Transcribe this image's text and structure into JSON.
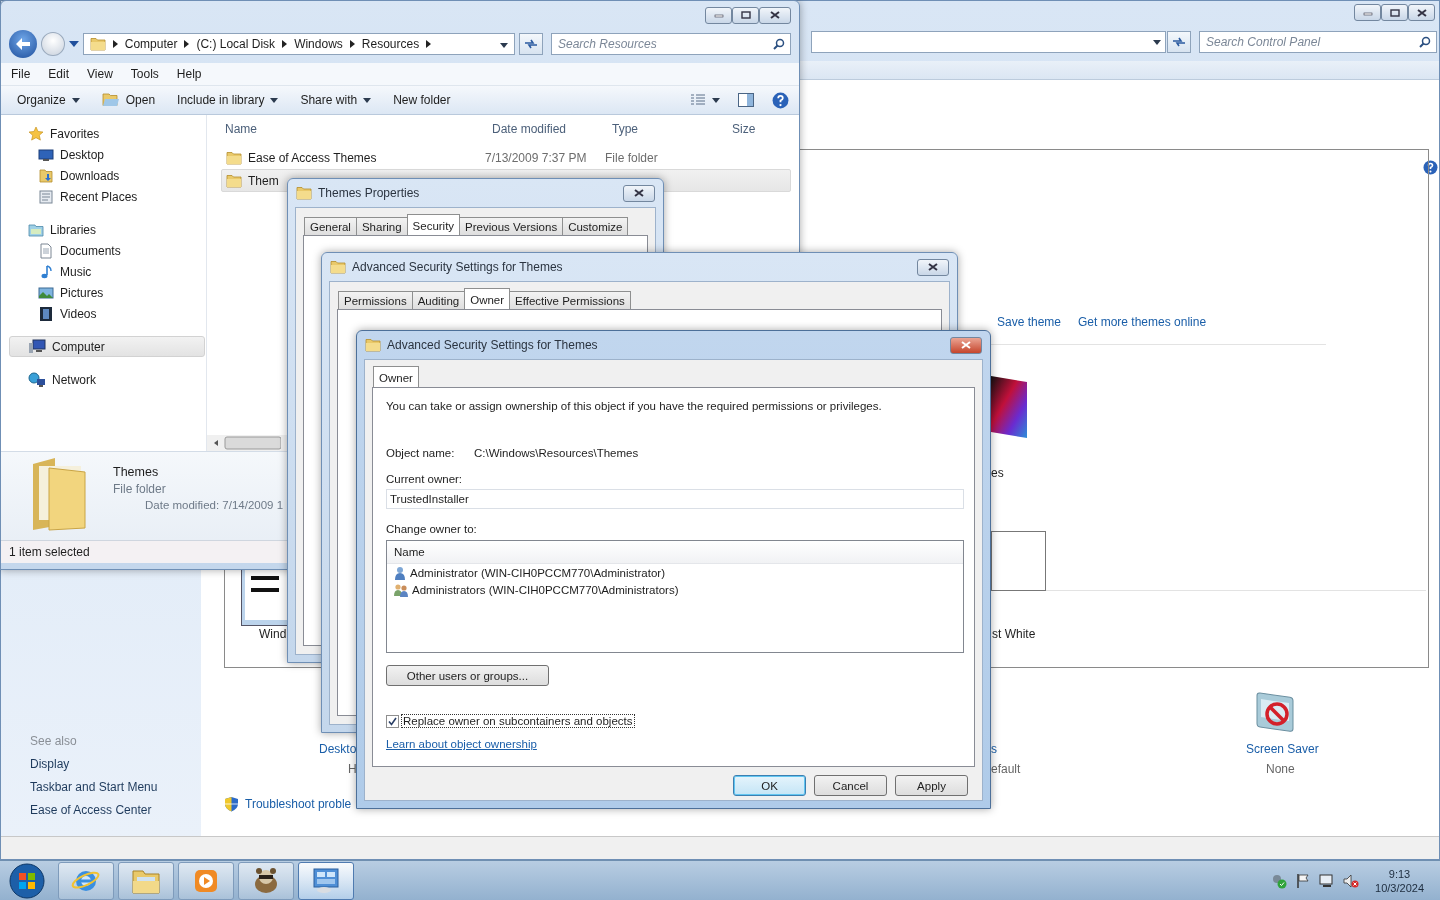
{
  "control_panel": {
    "search": {
      "placeholder": "Search Control Panel"
    },
    "theme_links": [
      "Save theme",
      "Get more themes online"
    ],
    "theme_labels": [
      "es",
      "st White",
      "Wind"
    ],
    "bottom_items": [
      {
        "label": "Deskto",
        "value": "H"
      },
      {
        "label": "s",
        "value": "efault"
      },
      {
        "label": "Screen Saver",
        "value": "None"
      }
    ],
    "see_also": {
      "heading": "See also",
      "links": [
        "Display",
        "Taskbar and Start Menu",
        "Ease of Access Center"
      ]
    },
    "troubleshoot_link": "Troubleshoot proble"
  },
  "explorer": {
    "breadcrumb": [
      "Computer",
      "(C:) Local Disk",
      "Windows",
      "Resources"
    ],
    "search": {
      "placeholder": "Search Resources"
    },
    "menu": [
      "File",
      "Edit",
      "View",
      "Tools",
      "Help"
    ],
    "toolbar": [
      {
        "label": "Organize",
        "kind": "menu"
      },
      {
        "label": "Open",
        "kind": "icon"
      },
      {
        "label": "Include in library",
        "kind": "menu"
      },
      {
        "label": "Share with",
        "kind": "menu"
      },
      {
        "label": "New folder",
        "kind": "plain"
      }
    ],
    "nav": [
      {
        "label": "Favorites",
        "kind": "star",
        "selected": false,
        "children": [
          {
            "label": "Desktop",
            "kind": "desktop",
            "selected": false
          },
          {
            "label": "Downloads",
            "kind": "downloads",
            "selected": false
          },
          {
            "label": "Recent Places",
            "kind": "recent",
            "selected": false
          }
        ]
      },
      {
        "label": "Libraries",
        "kind": "library",
        "selected": false,
        "children": [
          {
            "label": "Documents",
            "kind": "document",
            "selected": false
          },
          {
            "label": "Music",
            "kind": "music",
            "selected": false
          },
          {
            "label": "Pictures",
            "kind": "picture",
            "selected": false
          },
          {
            "label": "Videos",
            "kind": "video",
            "selected": false
          }
        ]
      },
      {
        "label": "Computer",
        "kind": "computer",
        "selected": true
      },
      {
        "label": "Network",
        "kind": "network",
        "selected": false
      }
    ],
    "columns": [
      "Name",
      "Date modified",
      "Type",
      "Size"
    ],
    "rows": [
      {
        "name": "Ease of Access Themes",
        "date": "7/13/2009 7:37 PM",
        "type": "File folder",
        "selected": false
      },
      {
        "name": "Them",
        "selected": true
      }
    ],
    "details": {
      "name": "Themes",
      "type": "File folder",
      "modified": "Date modified: 7/14/2009 1"
    },
    "status": "1 item selected"
  },
  "properties_dialog": {
    "title": "Themes Properties",
    "tabs": [
      {
        "label": "General",
        "selected": false
      },
      {
        "label": "Sharing",
        "selected": false
      },
      {
        "label": "Security",
        "selected": true
      },
      {
        "label": "Previous Versions",
        "selected": false
      },
      {
        "label": "Customize",
        "selected": false
      }
    ]
  },
  "security_dialog": {
    "title": "Advanced Security Settings for Themes",
    "tabs": [
      {
        "label": "Permissions",
        "selected": false
      },
      {
        "label": "Auditing",
        "selected": false
      },
      {
        "label": "Owner",
        "selected": true
      },
      {
        "label": "Effective Permissions",
        "selected": false
      }
    ]
  },
  "owner_dialog": {
    "title": "Advanced Security Settings for Themes",
    "tabs": [
      {
        "label": "Owner",
        "selected": true
      }
    ],
    "intro": "You can take or assign ownership of this object if you have the required permissions or privileges.",
    "object_name_label": "Object name:",
    "object_name": "C:\\Windows\\Resources\\Themes",
    "current_owner_label": "Current owner:",
    "current_owner": "TrustedInstaller",
    "change_owner_label": "Change owner to:",
    "list_header": "Name",
    "owners": [
      {
        "name": "Administrator (WIN-CIH0PCCM770\\Administrator)",
        "kind": "user",
        "selected": false
      },
      {
        "name": "Administrators (WIN-CIH0PCCM770\\Administrators)",
        "kind": "group",
        "selected": false
      }
    ],
    "other_button": "Other users or groups...",
    "replace": {
      "label": "Replace owner on subcontainers and objects",
      "checked": true
    },
    "learn_link": "Learn about object ownership",
    "buttons": [
      {
        "label": "OK",
        "default": true
      },
      {
        "label": "Cancel",
        "default": false
      },
      {
        "label": "Apply",
        "default": false
      }
    ]
  },
  "taskbar": {
    "apps": [
      {
        "kind": "browser",
        "active": false
      },
      {
        "kind": "explorer",
        "active": false
      },
      {
        "kind": "media",
        "active": false
      },
      {
        "kind": "animal",
        "active": false
      },
      {
        "kind": "control",
        "active": true
      }
    ],
    "clock": {
      "time": "9:13",
      "date": "10/3/2024"
    }
  }
}
